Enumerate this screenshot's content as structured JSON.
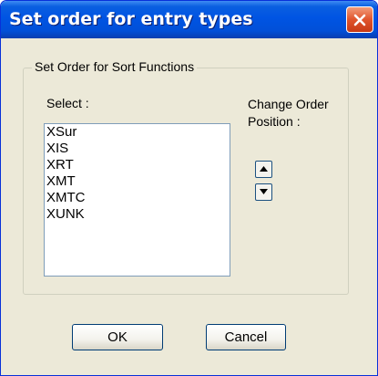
{
  "window": {
    "title": "Set order for entry types"
  },
  "group": {
    "label": "Set Order for Sort Functions"
  },
  "select": {
    "label": "Select :",
    "items": [
      "XSur",
      "XIS",
      "XRT",
      "XMT",
      "XMTC",
      "XUNK"
    ]
  },
  "change_order": {
    "label": "Change Order Position :"
  },
  "buttons": {
    "ok": "OK",
    "cancel": "Cancel"
  },
  "colors": {
    "titlebar": "#0054e3",
    "close": "#e0542c",
    "dialog_bg": "#ece9d8"
  }
}
